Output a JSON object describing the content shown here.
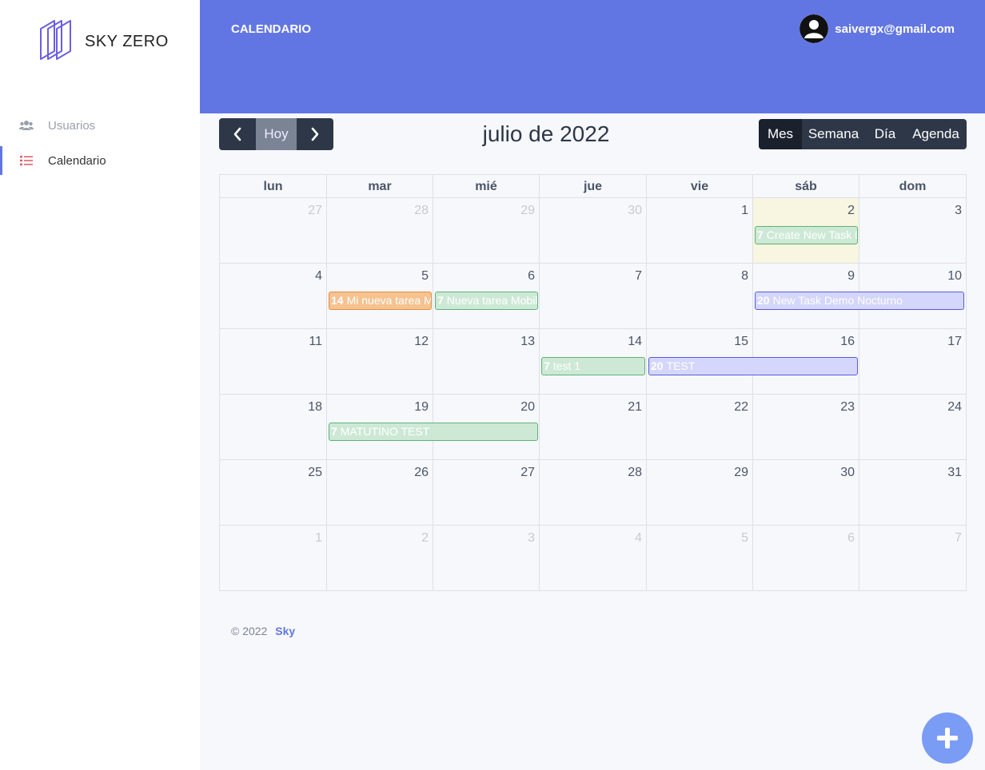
{
  "brand": {
    "name": "SKY ZERO",
    "logo_icon": "layers-logo-icon"
  },
  "sidebar": {
    "items": [
      {
        "label": "Usuarios",
        "icon": "users-icon",
        "active": false
      },
      {
        "label": "Calendario",
        "icon": "list-icon",
        "active": true,
        "icon_color": "#e25563"
      }
    ]
  },
  "header": {
    "title": "CALENDARIO",
    "user_email": "saivergx@gmail.com",
    "background": "#6276e3"
  },
  "toolbar": {
    "prev_icon": "chevron-left-icon",
    "today_label": "Hoy",
    "next_icon": "chevron-right-icon",
    "title": "julio de 2022",
    "views": [
      "Mes",
      "Semana",
      "Día",
      "Agenda"
    ],
    "active_view": "Mes"
  },
  "calendar": {
    "weekdays": [
      "lun",
      "mar",
      "mié",
      "jue",
      "vie",
      "sáb",
      "dom"
    ],
    "weeks": [
      [
        "27",
        "28",
        "29",
        "30",
        "1",
        "2",
        "3"
      ],
      [
        "4",
        "5",
        "6",
        "7",
        "8",
        "9",
        "10"
      ],
      [
        "11",
        "12",
        "13",
        "14",
        "15",
        "16",
        "17"
      ],
      [
        "18",
        "19",
        "20",
        "21",
        "22",
        "23",
        "24"
      ],
      [
        "25",
        "26",
        "27",
        "28",
        "29",
        "30",
        "31"
      ],
      [
        "1",
        "2",
        "3",
        "4",
        "5",
        "6",
        "7"
      ]
    ],
    "events": [
      {
        "week": 0,
        "start": 5,
        "span": 1,
        "badge": "7",
        "title": "Create New Task Demo",
        "color": "green"
      },
      {
        "week": 1,
        "start": 1,
        "span": 1,
        "badge": "14",
        "title": "Mi nueva tarea Mobile",
        "color": "orange"
      },
      {
        "week": 1,
        "start": 2,
        "span": 1,
        "badge": "7",
        "title": "Nueva tarea Mobile",
        "color": "green"
      },
      {
        "week": 1,
        "start": 5,
        "span": 2,
        "badge": "20",
        "title": "New Task Demo Nocturno",
        "color": "purple"
      },
      {
        "week": 2,
        "start": 3,
        "span": 1,
        "badge": "7",
        "title": "test 1",
        "color": "green"
      },
      {
        "week": 2,
        "start": 4,
        "span": 2,
        "badge": "20",
        "title": "TEST",
        "color": "purple"
      },
      {
        "week": 3,
        "start": 1,
        "span": 2,
        "badge": "7",
        "title": "MATUTINO TEST",
        "color": "green"
      }
    ]
  },
  "footer": {
    "copyright": "© 2022",
    "link_text": "Sky"
  },
  "fab": {
    "icon": "plus-icon",
    "color": "#7a9cf5"
  }
}
